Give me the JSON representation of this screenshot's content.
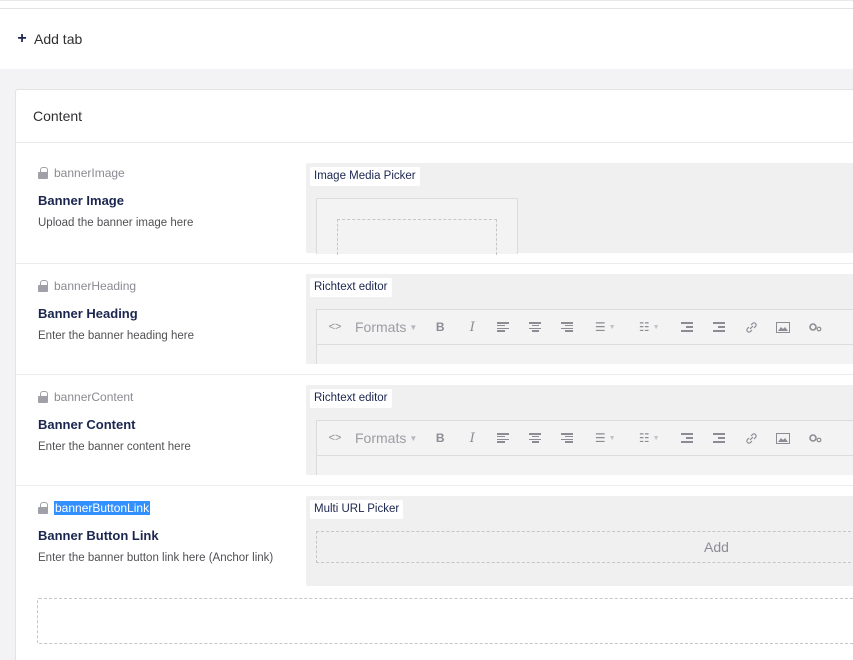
{
  "header": {
    "add_tab_label": "Add tab"
  },
  "group": {
    "title": "Content"
  },
  "properties": [
    {
      "alias": "bannerImage",
      "label": "Banner Image",
      "description": "Upload the banner image here",
      "editor": "Image Media Picker"
    },
    {
      "alias": "bannerHeading",
      "label": "Banner Heading",
      "description": "Enter the banner heading here",
      "editor": "Richtext editor"
    },
    {
      "alias": "bannerContent",
      "label": "Banner Content",
      "description": "Enter the banner content here",
      "editor": "Richtext editor"
    },
    {
      "alias": "bannerButtonLink",
      "label": "Banner Button Link",
      "description": "Enter the banner button link here (Anchor link)",
      "editor": "Multi URL Picker",
      "add_label": "Add"
    }
  ],
  "rte_toolbar": {
    "code_glyph": "<>",
    "formats_label": "Formats",
    "bold_glyph": "B",
    "italic_glyph": "I",
    "link_icon": "link-icon",
    "image_icon": "image-icon",
    "macro_icon": "gears-icon"
  },
  "colors": {
    "selection": "#3390ff",
    "text_primary": "#1b264f",
    "muted": "#8c8c94",
    "editor_bg": "#f0f0f0"
  }
}
